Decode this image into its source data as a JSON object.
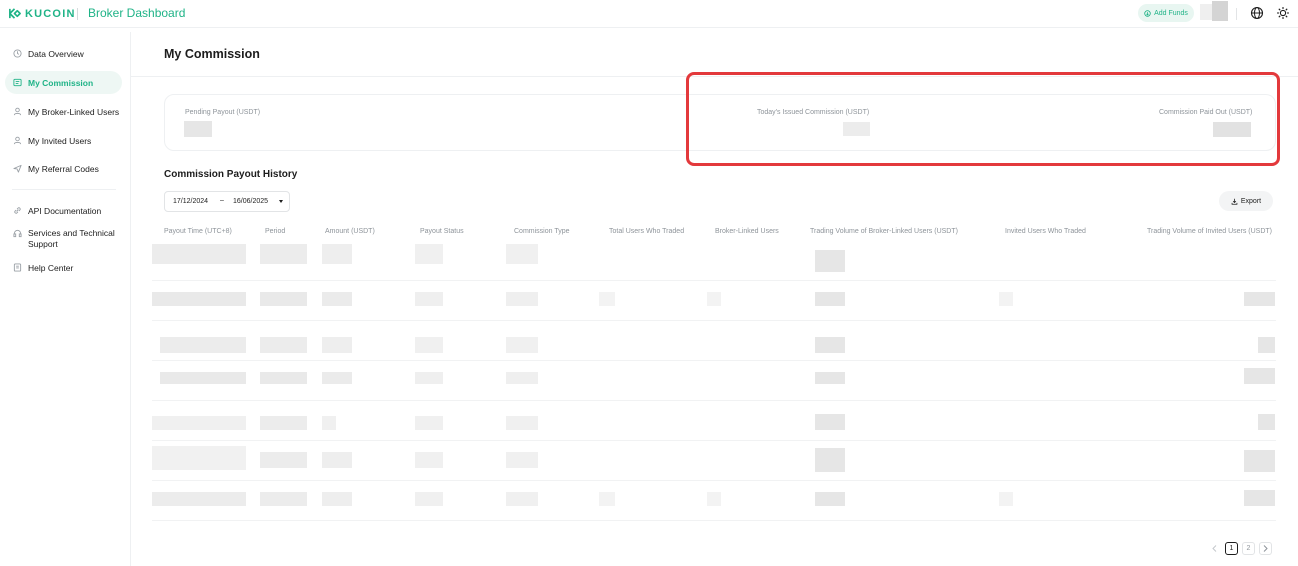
{
  "header": {
    "brand": "KUCOIN",
    "app_title": "Broker Dashboard",
    "add_funds_label": "Add Funds"
  },
  "sidebar": {
    "items": [
      {
        "label": "Data Overview",
        "icon": "clock-icon"
      },
      {
        "label": "My Commission",
        "icon": "commission-icon",
        "active": true
      },
      {
        "label": "My Broker-Linked Users",
        "icon": "user-icon"
      },
      {
        "label": "My Invited Users",
        "icon": "user-icon"
      },
      {
        "label": "My Referral Codes",
        "icon": "send-icon"
      }
    ],
    "items2": [
      {
        "label": "API Documentation",
        "icon": "link-icon"
      },
      {
        "label": "Services and Technical Support",
        "icon": "support-icon"
      },
      {
        "label": "Help Center",
        "icon": "help-icon"
      }
    ]
  },
  "main": {
    "page_title": "My Commission",
    "stats": {
      "pending_payout_label": "Pending Payout (USDT)",
      "todays_issued_label": "Today's Issued Commission (USDT)",
      "paid_out_label": "Commission Paid Out (USDT)"
    },
    "history_title": "Commission Payout History",
    "date_range": {
      "start": "17/12/2024",
      "separator": "–",
      "end": "16/06/2025"
    },
    "export_label": "Export",
    "table_headers": [
      "Payout Time (UTC+8)",
      "Period",
      "Amount (USDT)",
      "Payout Status",
      "Commission Type",
      "Total Users Who Traded",
      "Broker-Linked Users",
      "Trading Volume of Broker-Linked Users (USDT)",
      "Invited Users Who Traded",
      "Trading Volume of Invited Users (USDT)"
    ],
    "pagination": {
      "pages": [
        "1",
        "2"
      ],
      "current": "1"
    }
  },
  "colors": {
    "accent": "#1fb387",
    "highlight": "#e3393c",
    "muted_text": "#8e949a"
  }
}
